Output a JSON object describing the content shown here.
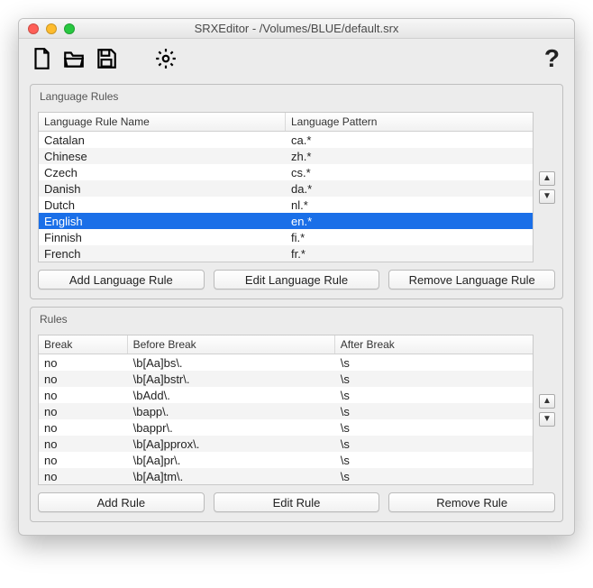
{
  "window": {
    "title": "SRXEditor - /Volumes/BLUE/default.srx"
  },
  "toolbar": {
    "new": "New File",
    "open": "Open File",
    "save": "Save File",
    "settings": "Settings",
    "help": "?"
  },
  "langbox": {
    "label": "Language Rules",
    "columns": {
      "name": "Language Rule Name",
      "pattern": "Language Pattern"
    },
    "rows": [
      {
        "name": "Catalan",
        "pattern": "ca.*",
        "selected": false
      },
      {
        "name": "Chinese",
        "pattern": "zh.*",
        "selected": false
      },
      {
        "name": "Czech",
        "pattern": "cs.*",
        "selected": false
      },
      {
        "name": "Danish",
        "pattern": "da.*",
        "selected": false
      },
      {
        "name": "Dutch",
        "pattern": "nl.*",
        "selected": false
      },
      {
        "name": "English",
        "pattern": "en.*",
        "selected": true
      },
      {
        "name": "Finnish",
        "pattern": "fi.*",
        "selected": false
      },
      {
        "name": "French",
        "pattern": "fr.*",
        "selected": false
      }
    ],
    "buttons": {
      "add": "Add Language Rule",
      "edit": "Edit Language Rule",
      "remove": "Remove Language Rule"
    },
    "move": {
      "up": "▲",
      "down": "▼"
    }
  },
  "rulebox": {
    "label": "Rules",
    "columns": {
      "break": "Break",
      "before": "Before Break",
      "after": "After Break"
    },
    "rows": [
      {
        "break": "no",
        "before": "\\b[Aa]bs\\.",
        "after": "\\s"
      },
      {
        "break": "no",
        "before": "\\b[Aa]bstr\\.",
        "after": "\\s"
      },
      {
        "break": "no",
        "before": "\\bAdd\\.",
        "after": "\\s"
      },
      {
        "break": "no",
        "before": "\\bapp\\.",
        "after": "\\s"
      },
      {
        "break": "no",
        "before": "\\bappr\\.",
        "after": "\\s"
      },
      {
        "break": "no",
        "before": "\\b[Aa]pprox\\.",
        "after": "\\s"
      },
      {
        "break": "no",
        "before": "\\b[Aa]pr\\.",
        "after": "\\s"
      },
      {
        "break": "no",
        "before": "\\b[Aa]tm\\.",
        "after": "\\s"
      }
    ],
    "buttons": {
      "add": "Add Rule",
      "edit": "Edit Rule",
      "remove": "Remove Rule"
    },
    "move": {
      "up": "▲",
      "down": "▼"
    }
  }
}
